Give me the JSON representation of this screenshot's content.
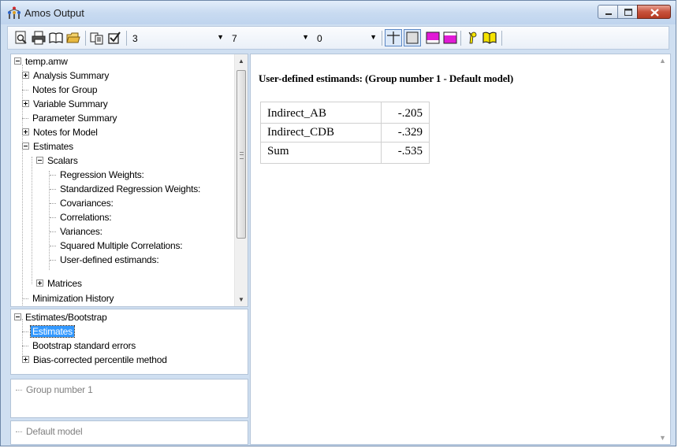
{
  "window": {
    "title": "Amos Output"
  },
  "toolbar": {
    "combo1": "3",
    "combo2": "7",
    "combo3": "0",
    "icons": [
      "print-preview-icon",
      "print-icon",
      "book-icon",
      "open-folder-icon",
      "copy-icon",
      "checkbox-icon",
      "grid-lines-icon",
      "box-icon",
      "table-header-icon",
      "table-footer-icon",
      "help-icon",
      "book-open-icon"
    ]
  },
  "tree": {
    "root": "temp.amw",
    "items": {
      "analysis_summary": "Analysis Summary",
      "notes_group": "Notes for Group",
      "variable_summary": "Variable Summary",
      "parameter_summary": "Parameter Summary",
      "notes_model": "Notes for Model",
      "estimates": "Estimates",
      "scalars": "Scalars",
      "regression_weights": "Regression Weights:",
      "std_regression_weights": "Standardized Regression Weights:",
      "covariances": "Covariances:",
      "correlations": "Correlations:",
      "variances": "Variances:",
      "smc": "Squared Multiple Correlations:",
      "user_defined": "User-defined estimands:",
      "matrices": "Matrices",
      "minimization": "Minimization History"
    }
  },
  "bootstrap": {
    "root": "Estimates/Bootstrap",
    "estimates": "Estimates",
    "bootstrap_se": "Bootstrap standard errors",
    "bias_corrected": "Bias-corrected percentile method"
  },
  "group_panel": {
    "item": "Group number 1"
  },
  "model_panel": {
    "item": "Default model"
  },
  "main": {
    "heading": "User-defined estimands: (Group number 1 - Default model)",
    "rows": [
      {
        "name": "Indirect_AB",
        "value": "-.205"
      },
      {
        "name": "Indirect_CDB",
        "value": "-.329"
      },
      {
        "name": "Sum",
        "value": "-.535"
      }
    ]
  },
  "colors": {
    "selection": "#3399ff",
    "close_button": "#c7523c",
    "frame": "#cfdff1"
  }
}
